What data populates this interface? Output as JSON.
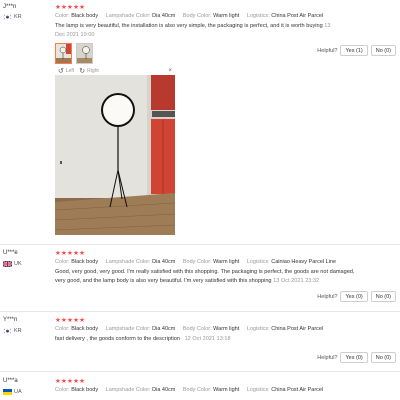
{
  "reviews": [
    {
      "user": "J***n",
      "country": "KR",
      "stars": "★★★★★",
      "color_label": "Color:",
      "color": "Black body",
      "shade_label": "Lampshade Color:",
      "shade": "Dia 40cm",
      "body_label": "Body Color:",
      "body": "Warm light",
      "logistics_label": "Logistics:",
      "logistics": "China Post Air Parcel",
      "text": "The lamp is very beautiful, the installation is also very simple, the packaging is perfect, and it is worth buying",
      "date": "13 Dec 2021 19:00",
      "helpful_label": "Helpful?",
      "yes": "Yes (1)",
      "no": "No (0)"
    },
    {
      "user": "U***e",
      "country": "UK",
      "stars": "★★★★★",
      "color_label": "Color:",
      "color": "Black body",
      "shade_label": "Lampshade Color:",
      "shade": "Dia 40cm",
      "body_label": "Body Color:",
      "body": "Warm light",
      "logistics_label": "Logistics:",
      "logistics": "Cainiao Heavy Parcel Line",
      "text": "Good, very good, very good. I'm really satisfied with this shopping. The packaging is perfect, the goods are not damaged, very good, and the lamp body is also very beautiful. I'm very satisfied with this shopping",
      "date": "13 Oct 2021 23:32",
      "helpful_label": "Helpful?",
      "yes": "Yes (0)",
      "no": "No (0)"
    },
    {
      "user": "Y***n",
      "country": "KR",
      "stars": "★★★★★",
      "color_label": "Color:",
      "color": "Black body",
      "shade_label": "Lampshade Color:",
      "shade": "Dia 40cm",
      "body_label": "Body Color:",
      "body": "Warm light",
      "logistics_label": "Logistics:",
      "logistics": "China Post Air Parcel",
      "text": "fast delivery , the goods conform to the description",
      "date": "12 Oct 2021 13:18",
      "helpful_label": "Helpful?",
      "yes": "Yes (0)",
      "no": "No (0)"
    },
    {
      "user": "U***a",
      "country": "UA",
      "stars": "★★★★★",
      "color_label": "Color:",
      "color": "Black body",
      "shade_label": "Lampshade Color:",
      "shade": "Dia 40cm",
      "body_label": "Body Color:",
      "body": "Warm light",
      "logistics_label": "Logistics:",
      "logistics": "China Post Air Parcel"
    }
  ],
  "viewer": {
    "left_label": "Left",
    "right_label": "Right",
    "close": "×"
  },
  "colors": {
    "star": "#ff4747",
    "thumb_active_border": "#ff7a45"
  },
  "icons": {
    "rotate_left": "rotate-left-icon",
    "rotate_right": "rotate-right-icon",
    "close": "close-icon"
  }
}
